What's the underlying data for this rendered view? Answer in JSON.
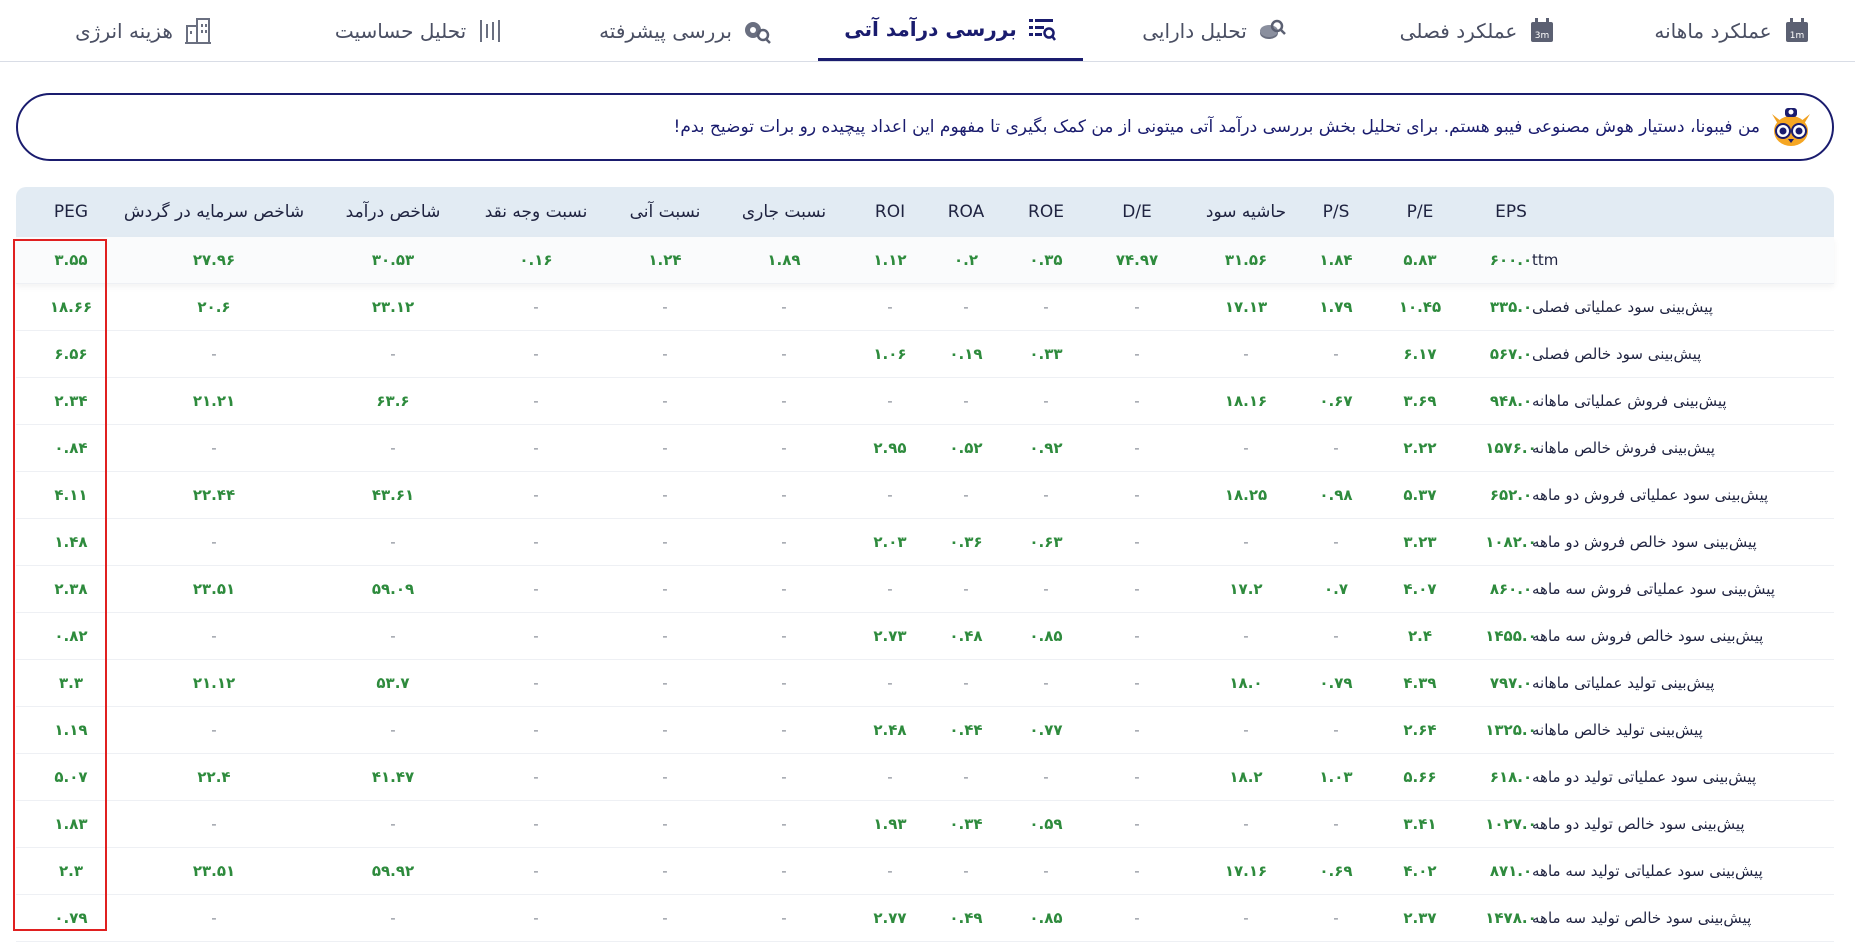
{
  "tabs": [
    {
      "label": "عملکرد ماهانه",
      "icon": "calendar-1m-icon",
      "active": false
    },
    {
      "label": "عملکرد فصلی",
      "icon": "calendar-3m-icon",
      "active": false
    },
    {
      "label": "تحلیل دارایی",
      "icon": "coins-search-icon",
      "active": false
    },
    {
      "label": "بررسی درآمد آتی",
      "icon": "list-search-icon",
      "active": true
    },
    {
      "label": "بررسی پیشرفته",
      "icon": "gears-search-icon",
      "active": false
    },
    {
      "label": "تحلیل حساسیت",
      "icon": "bars-icon",
      "active": false
    },
    {
      "label": "هزینه انرژی",
      "icon": "building-icon",
      "active": false
    }
  ],
  "assistant": {
    "message": "من فیبونا، دستیار هوش مصنوعی فیبو هستم. برای تحلیل بخش بررسی درآمد آتی میتونی از من کمک بگیری تا مفهوم این اعداد پیچیده رو برات توضیح بدم!",
    "icon": "owl-icon"
  },
  "table": {
    "columns": [
      "EPS",
      "P/E",
      "P/S",
      "حاشیه سود",
      "D/E",
      "ROE",
      "ROA",
      "ROI",
      "نسبت جاری",
      "نسبت آنی",
      "نسبت وجه نقد",
      "شاخص درآمد",
      "شاخص سرمایه در گردش",
      "PEG"
    ],
    "rows": [
      {
        "label": "ttm",
        "cells": [
          "۶۰۰.۰",
          "۵.۸۳",
          "۱.۸۴",
          "۳۱.۵۶",
          "۷۴.۹۷",
          "۰.۳۵",
          "۰.۲",
          "۱.۱۲",
          "۱.۸۹",
          "۱.۲۴",
          "۰.۱۶",
          "۳۰.۵۳",
          "۲۷.۹۶",
          "۳.۵۵"
        ]
      },
      {
        "label": "پیش‌بینی سود عملیاتی فصلی",
        "cells": [
          "۳۳۵.۰",
          "۱۰.۴۵",
          "۱.۷۹",
          "۱۷.۱۳",
          "-",
          "-",
          "-",
          "-",
          "-",
          "-",
          "-",
          "۲۳.۱۲",
          "۲۰.۶",
          "۱۸.۶۶"
        ]
      },
      {
        "label": "پیش‌بینی سود خالص فصلی",
        "cells": [
          "۵۶۷.۰",
          "۶.۱۷",
          "-",
          "-",
          "-",
          "۰.۳۳",
          "۰.۱۹",
          "۱.۰۶",
          "-",
          "-",
          "-",
          "-",
          "-",
          "۶.۵۶"
        ]
      },
      {
        "label": "پیش‌بینی فروش عملیاتی ماهانه",
        "cells": [
          "۹۴۸.۰",
          "۳.۶۹",
          "۰.۶۷",
          "۱۸.۱۶",
          "-",
          "-",
          "-",
          "-",
          "-",
          "-",
          "-",
          "۶۳.۶",
          "۲۱.۲۱",
          "۲.۳۴"
        ]
      },
      {
        "label": "پیش‌بینی فروش خالص ماهانه",
        "cells": [
          "۱۵۷۶.۰",
          "۲.۲۲",
          "-",
          "-",
          "-",
          "۰.۹۲",
          "۰.۵۲",
          "۲.۹۵",
          "-",
          "-",
          "-",
          "-",
          "-",
          "۰.۸۴"
        ]
      },
      {
        "label": "پیش‌بینی سود عملیاتی فروش دو ماهه",
        "cells": [
          "۶۵۲.۰",
          "۵.۳۷",
          "۰.۹۸",
          "۱۸.۲۵",
          "-",
          "-",
          "-",
          "-",
          "-",
          "-",
          "-",
          "۴۳.۶۱",
          "۲۲.۴۴",
          "۴.۱۱"
        ]
      },
      {
        "label": "پیش‌بینی سود خالص فروش دو ماهه",
        "cells": [
          "۱۰۸۲.۰",
          "۳.۲۳",
          "-",
          "-",
          "-",
          "۰.۶۳",
          "۰.۳۶",
          "۲.۰۳",
          "-",
          "-",
          "-",
          "-",
          "-",
          "۱.۴۸"
        ]
      },
      {
        "label": "پیش‌بینی سود عملیاتی فروش سه ماهه",
        "cells": [
          "۸۶۰.۰",
          "۴.۰۷",
          "۰.۷",
          "۱۷.۲",
          "-",
          "-",
          "-",
          "-",
          "-",
          "-",
          "-",
          "۵۹.۰۹",
          "۲۳.۵۱",
          "۲.۳۸"
        ]
      },
      {
        "label": "پیش‌بینی سود خالص فروش سه ماهه",
        "cells": [
          "۱۴۵۵.۰",
          "۲.۴",
          "-",
          "-",
          "-",
          "۰.۸۵",
          "۰.۴۸",
          "۲.۷۳",
          "-",
          "-",
          "-",
          "-",
          "-",
          "۰.۸۲"
        ]
      },
      {
        "label": "پیش‌بینی تولید عملیاتی ماهانه",
        "cells": [
          "۷۹۷.۰",
          "۴.۳۹",
          "۰.۷۹",
          "۱۸.۰",
          "-",
          "-",
          "-",
          "-",
          "-",
          "-",
          "-",
          "۵۳.۷",
          "۲۱.۱۲",
          "۳.۳"
        ]
      },
      {
        "label": "پیش‌بینی تولید خالص ماهانه",
        "cells": [
          "۱۳۲۵.۰",
          "۲.۶۴",
          "-",
          "-",
          "-",
          "۰.۷۷",
          "۰.۴۴",
          "۲.۴۸",
          "-",
          "-",
          "-",
          "-",
          "-",
          "۱.۱۹"
        ]
      },
      {
        "label": "پیش‌بینی سود عملیاتی تولید دو ماهه",
        "cells": [
          "۶۱۸.۰",
          "۵.۶۶",
          "۱.۰۳",
          "۱۸.۲",
          "-",
          "-",
          "-",
          "-",
          "-",
          "-",
          "-",
          "۴۱.۴۷",
          "۲۲.۴",
          "۵.۰۷"
        ]
      },
      {
        "label": "پیش‌بینی سود خالص تولید دو ماهه",
        "cells": [
          "۱۰۲۷.۰",
          "۳.۴۱",
          "-",
          "-",
          "-",
          "۰.۵۹",
          "۰.۳۴",
          "۱.۹۳",
          "-",
          "-",
          "-",
          "-",
          "-",
          "۱.۸۳"
        ]
      },
      {
        "label": "پیش‌بینی سود عملیاتی تولید سه ماهه",
        "cells": [
          "۸۷۱.۰",
          "۴.۰۲",
          "۰.۶۹",
          "۱۷.۱۶",
          "-",
          "-",
          "-",
          "-",
          "-",
          "-",
          "-",
          "۵۹.۹۲",
          "۲۳.۵۱",
          "۲.۳"
        ]
      },
      {
        "label": "پیش‌بینی سود خالص تولید سه ماهه",
        "cells": [
          "۱۴۷۸.۰",
          "۲.۳۷",
          "-",
          "-",
          "-",
          "۰.۸۵",
          "۰.۴۹",
          "۲.۷۷",
          "-",
          "-",
          "-",
          "-",
          "-",
          "۰.۷۹"
        ]
      }
    ]
  },
  "colors": {
    "accent": "#1a1c6e",
    "value": "#2e8b3d",
    "header_bg": "#e2ebf3",
    "highlight": "#e02020"
  }
}
